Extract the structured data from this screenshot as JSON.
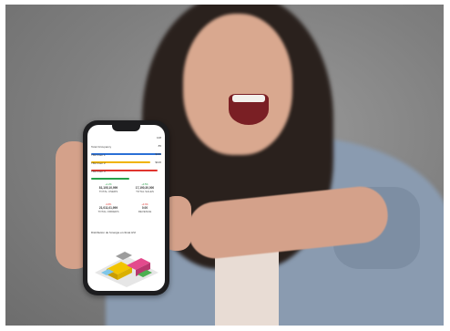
{
  "phone_screen": {
    "rows": [
      {
        "label": "Total Occupancy",
        "value": "108",
        "color": "#2a6fd6"
      },
      {
        "label": "TB2 Floor 1",
        "value": "85",
        "color": "#f0b400"
      },
      {
        "label": "TB2 Floor 2",
        "value": "$180",
        "color": "#e0342f"
      },
      {
        "label": "TB2 Floor 3",
        "value": "$100",
        "color": "#27a14a"
      }
    ],
    "stats": [
      {
        "delta": "+1.2%",
        "value": "81,105,10,999",
        "label": "TOTAL USERS",
        "color": "#27a14a"
      },
      {
        "delta": "+0.5%",
        "value": "17,190,30,000",
        "label": "TOTAL SALES",
        "color": "#27a14a"
      },
      {
        "delta": "-0.8%",
        "value": "21,011,01,999",
        "label": "TOTAL ORDERS",
        "color": "#e0342f"
      },
      {
        "delta": "+0.3%",
        "value": "0.00",
        "label": "REVENUE",
        "color": "#e0342f"
      }
    ],
    "chart_title": "Distribution de l'énergie et climat HVI"
  }
}
